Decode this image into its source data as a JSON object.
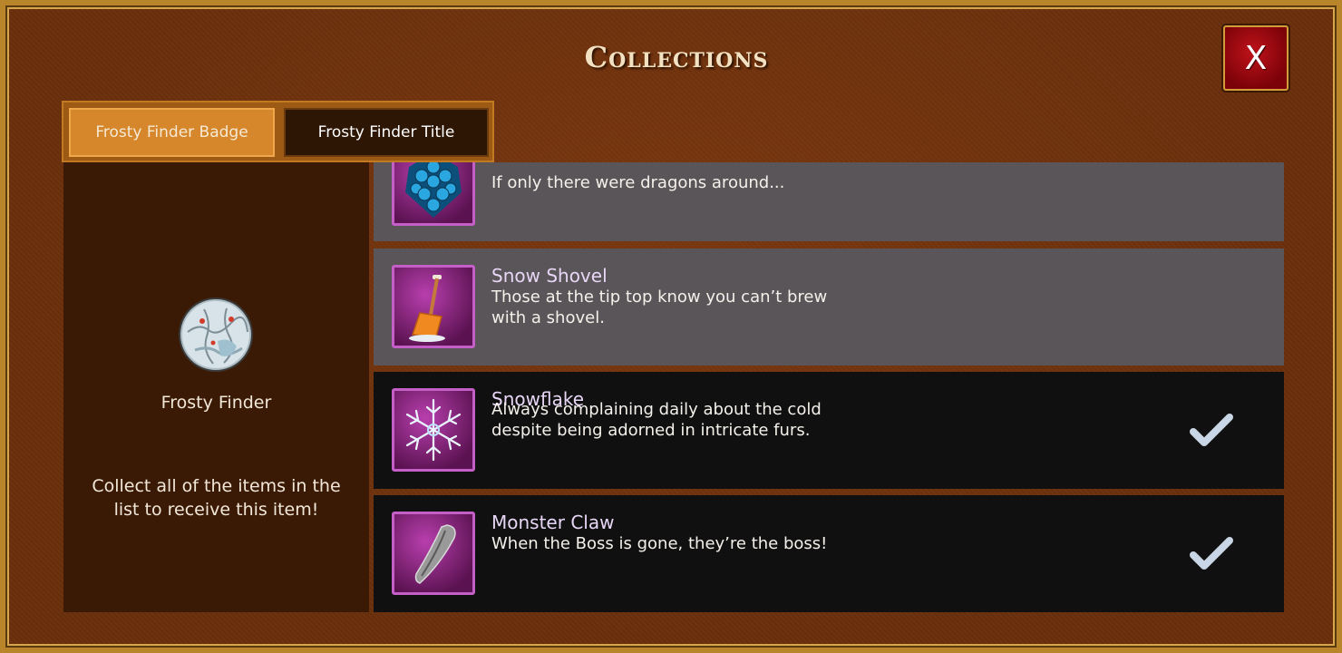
{
  "window": {
    "title": "Collections",
    "close_label": "X"
  },
  "tabs": [
    {
      "label": "Frosty Finder Badge",
      "active": true
    },
    {
      "label": "Frosty Finder Title",
      "active": false
    }
  ],
  "badge": {
    "icon": "frosty-finder-badge-icon",
    "name": "Frosty Finder",
    "description": "Collect all of the items in the list to receive this item!"
  },
  "items": [
    {
      "name": "",
      "description": "If only there were dragons around...",
      "icon": "dragon-scale-icon",
      "collected": false
    },
    {
      "name": "Snow Shovel",
      "description": "Those at the tip top know you can’t brew with a shovel.",
      "icon": "shovel-icon",
      "collected": false
    },
    {
      "name": "Snowflake",
      "description": "Always complaining daily about the cold despite being adorned in intricate furs.",
      "icon": "snowflake-icon",
      "collected": true
    },
    {
      "name": "Monster Claw",
      "description": "When the Boss is gone, they’re the boss!",
      "icon": "claw-icon",
      "collected": true
    }
  ],
  "colors": {
    "frame_gold": "#b9852b",
    "panel_brown": "#3b1a05",
    "row_unowned": "#5a5559",
    "row_owned": "#101011",
    "icon_border": "#c55fc8",
    "close_red": "#c0121a"
  }
}
